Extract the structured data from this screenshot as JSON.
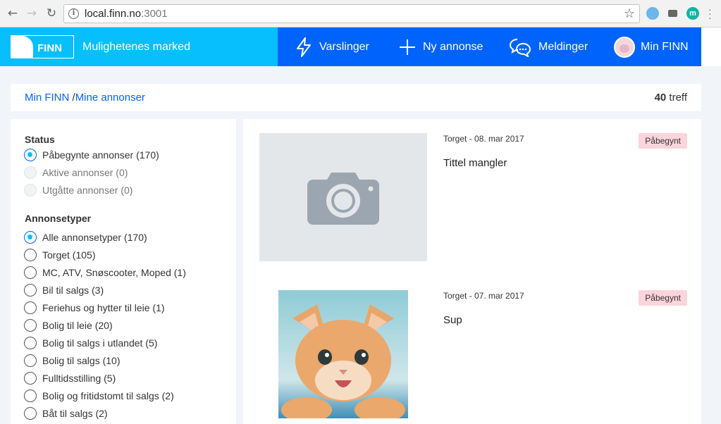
{
  "browser": {
    "url_host": "local.finn.no",
    "url_port": ":3001",
    "extension_letter": "m"
  },
  "header": {
    "logo_text": "FINN",
    "tagline": "Mulighetenes marked",
    "nav": [
      {
        "label": "Varslinger",
        "icon": "lightning-icon"
      },
      {
        "label": "Ny annonse",
        "icon": "plus-icon"
      },
      {
        "label": "Meldinger",
        "icon": "chat-icon"
      },
      {
        "label": "Min FINN",
        "icon": "avatar"
      }
    ],
    "colors": {
      "brand_light": "#06bffc",
      "brand_dark": "#0063fb"
    }
  },
  "breadcrumb": {
    "root": "Min FINN",
    "separator": " /",
    "current": "Mine annonser",
    "hits_count": "40",
    "hits_label": " treff"
  },
  "filters": {
    "status": {
      "heading": "Status",
      "options": [
        {
          "label": "Påbegynte annonser (170)",
          "checked": true,
          "disabled": false
        },
        {
          "label": "Aktive annonser (0)",
          "checked": false,
          "disabled": true
        },
        {
          "label": "Utgåtte annonser (0)",
          "checked": false,
          "disabled": true
        }
      ]
    },
    "types": {
      "heading": "Annonsetyper",
      "options": [
        {
          "label": "Alle annonsetyper (170)",
          "checked": true
        },
        {
          "label": "Torget (105)",
          "checked": false
        },
        {
          "label": "MC, ATV, Snøscooter, Moped (1)",
          "checked": false
        },
        {
          "label": "Bil til salgs (3)",
          "checked": false
        },
        {
          "label": "Feriehus og hytter til leie (1)",
          "checked": false
        },
        {
          "label": "Bolig til leie (20)",
          "checked": false
        },
        {
          "label": "Bolig til salgs i utlandet (5)",
          "checked": false
        },
        {
          "label": "Bolig til salgs (10)",
          "checked": false
        },
        {
          "label": "Fulltidsstilling (5)",
          "checked": false
        },
        {
          "label": "Bolig og fritidstomt til salgs (2)",
          "checked": false
        },
        {
          "label": "Båt til salgs (2)",
          "checked": false
        }
      ]
    }
  },
  "ads": [
    {
      "meta": "Torget - 08. mar 2017",
      "title": "Tittel mangler",
      "status": "Påbegynt",
      "image": "camera-placeholder-icon"
    },
    {
      "meta": "Torget - 07. mar 2017",
      "title": "Sup",
      "status": "Påbegynt",
      "image": "kitten-photo"
    }
  ]
}
